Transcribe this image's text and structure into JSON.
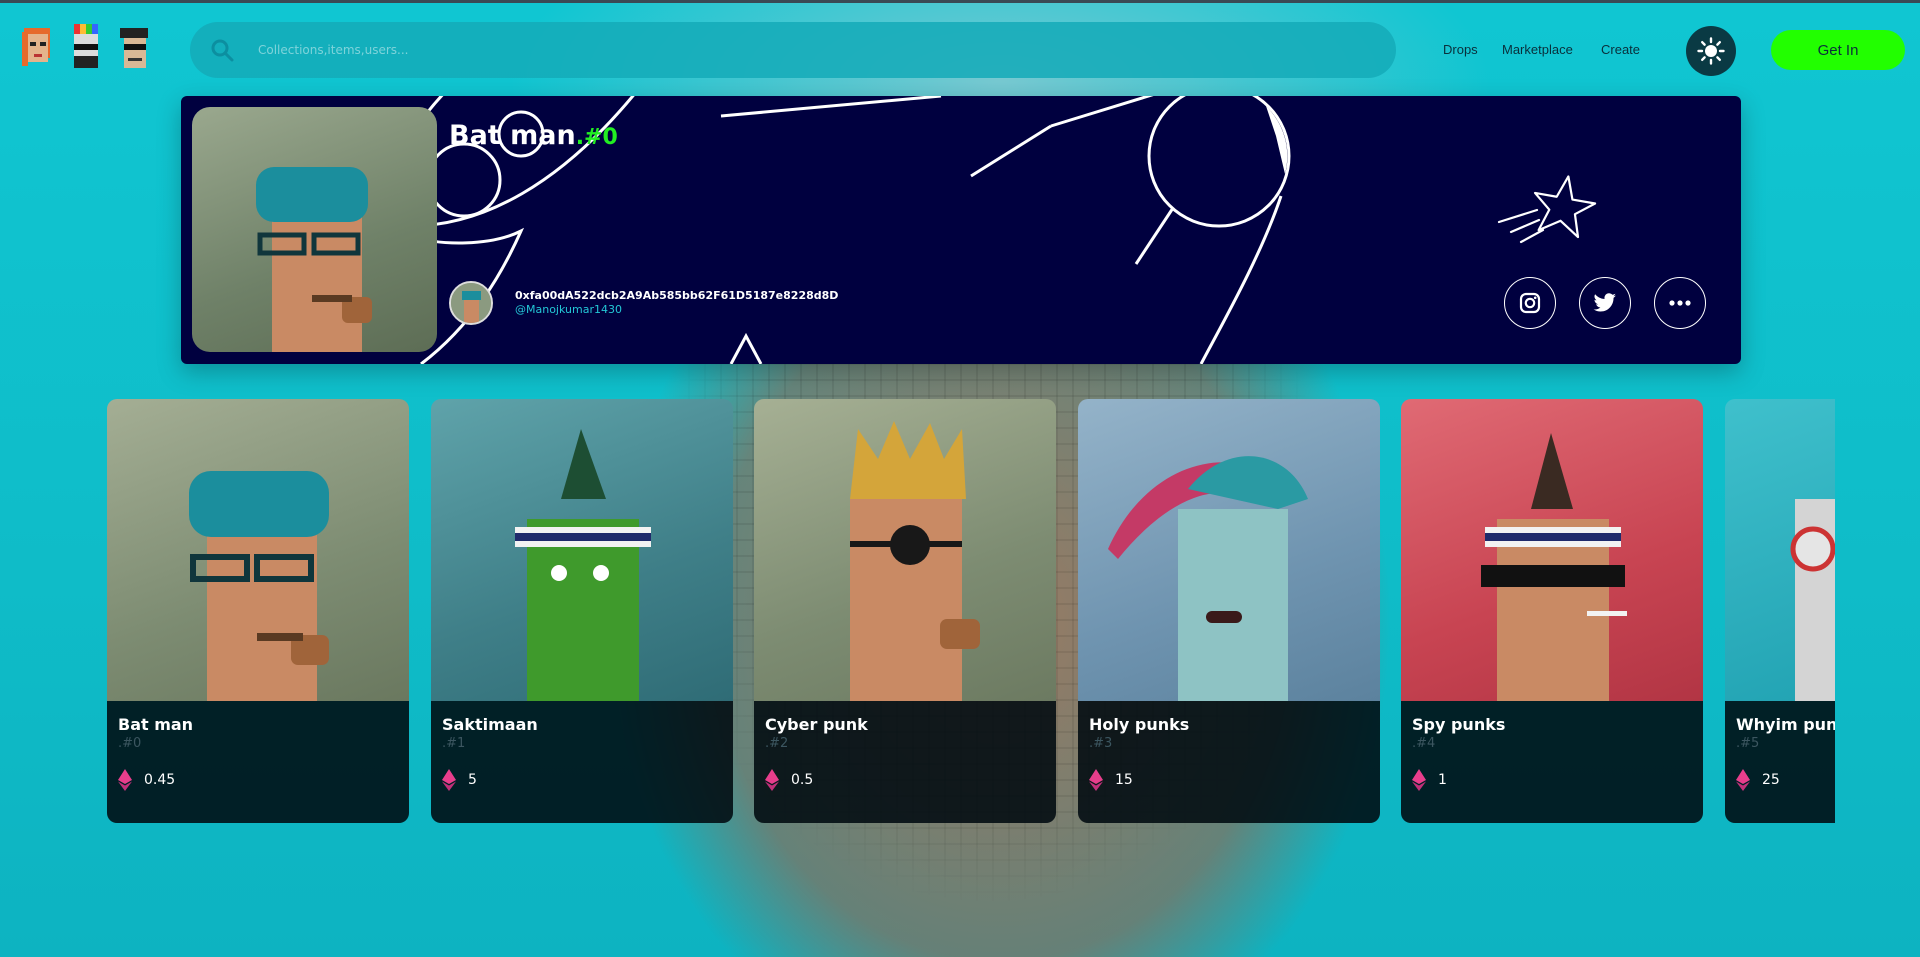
{
  "header": {
    "search_placeholder": "Collections,items,users...",
    "nav": [
      "Drops",
      "Marketplace",
      "Create"
    ],
    "get_in_label": "Get In"
  },
  "banner": {
    "title": "Bat man",
    "token_number": ".#0",
    "owner_address": "0xfa00dA522dcb2A9Ab585bb62F61D5187e8228d8D",
    "owner_handle": "@Manojkumar1430"
  },
  "cards": [
    {
      "name": "Bat man",
      "number": ".#0",
      "price": "0.45",
      "bg": "#8d9c82"
    },
    {
      "name": "Saktimaan",
      "number": ".#1",
      "price": "5",
      "bg": "#4e8f97"
    },
    {
      "name": "Cyber punk",
      "number": ".#2",
      "price": "0.5",
      "bg": "#8f9e83"
    },
    {
      "name": "Holy punks",
      "number": ".#3",
      "price": "15",
      "bg": "#7b9cb6"
    },
    {
      "name": "Spy punks",
      "number": ".#4",
      "price": "1",
      "bg": "#c44350"
    },
    {
      "name": "Whyim punks",
      "number": ".#5",
      "price": "25",
      "bg": "#2fa8b8"
    }
  ],
  "colors": {
    "accent": "#22ff00",
    "banner_bg": "#00003f",
    "page_bg": "#12c4cf",
    "eth": "#e83e8c"
  }
}
